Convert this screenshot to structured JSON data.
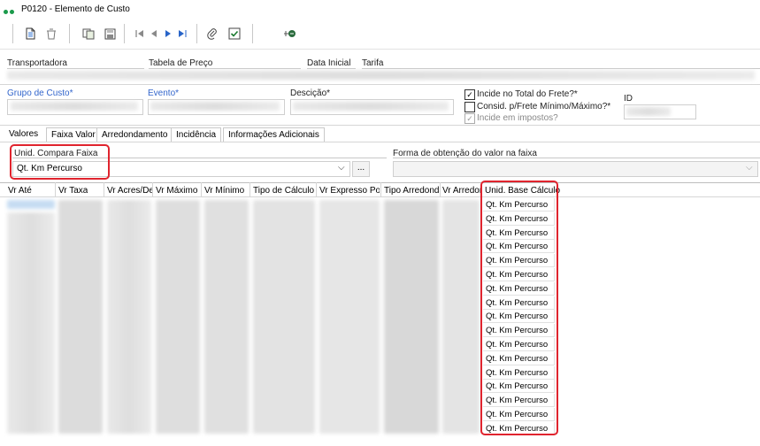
{
  "window": {
    "title": "P0120 - Elemento de Custo"
  },
  "toolbar": {
    "icons": [
      "new-doc-icon",
      "trash-icon",
      "copy-icon",
      "save-icon",
      "first-record-icon",
      "prev-record-icon",
      "next-record-icon",
      "last-record-icon",
      "attach-icon",
      "confirm-icon",
      "tool-icon"
    ]
  },
  "header": {
    "transportadora_label": "Transportadora",
    "tabela_label": "Tabela de Preço",
    "data_inicial_label": "Data Inicial",
    "tarifa_label": "Tarifa",
    "grupo_label": "Grupo de Custo*",
    "evento_label": "Evento*",
    "descricao_label": "Descição*",
    "incide_total_label": "Incide no Total do Frete?*",
    "consid_label": "Consid. p/Frete Mínimo/Máximo?*",
    "incide_impostos_label": "Incide em impostos?",
    "id_label": "ID"
  },
  "tabs": [
    "Valores",
    "Faixa Valor",
    "Arredondamento",
    "Incidência",
    "Informações Adicionais"
  ],
  "active_tab": "Faixa Valor",
  "faixa": {
    "unid_compara_label": "Unid. Compara Faixa",
    "unid_compara_value": "Qt. Km Percurso",
    "browse_label": "...",
    "forma_label": "Forma de obtenção do valor na faixa"
  },
  "grid": {
    "columns": [
      "Vr Até",
      "Vr Taxa",
      "Vr Acres/De",
      "Vr Máximo",
      "Vr Mínimo",
      "Tipo de Cálculo",
      "Vr Expresso Por",
      "Tipo Arredonda",
      "Vr Arredon",
      "Unid. Base Cálculo"
    ],
    "unid_base_values": [
      "Qt. Km Percurso",
      "Qt. Km Percurso",
      "Qt. Km Percurso",
      "Qt. Km Percurso",
      "Qt. Km Percurso",
      "Qt. Km Percurso",
      "Qt. Km Percurso",
      "Qt. Km Percurso",
      "Qt. Km Percurso",
      "Qt. Km Percurso",
      "Qt. Km Percurso",
      "Qt. Km Percurso",
      "Qt. Km Percurso",
      "Qt. Km Percurso",
      "Qt. Km Percurso",
      "Qt. Km Percurso",
      "Qt. Km Percurso"
    ]
  },
  "colors": {
    "highlight": "#e0242e",
    "status_dot": "#1a9a4b",
    "required_label": "#3366cc"
  }
}
